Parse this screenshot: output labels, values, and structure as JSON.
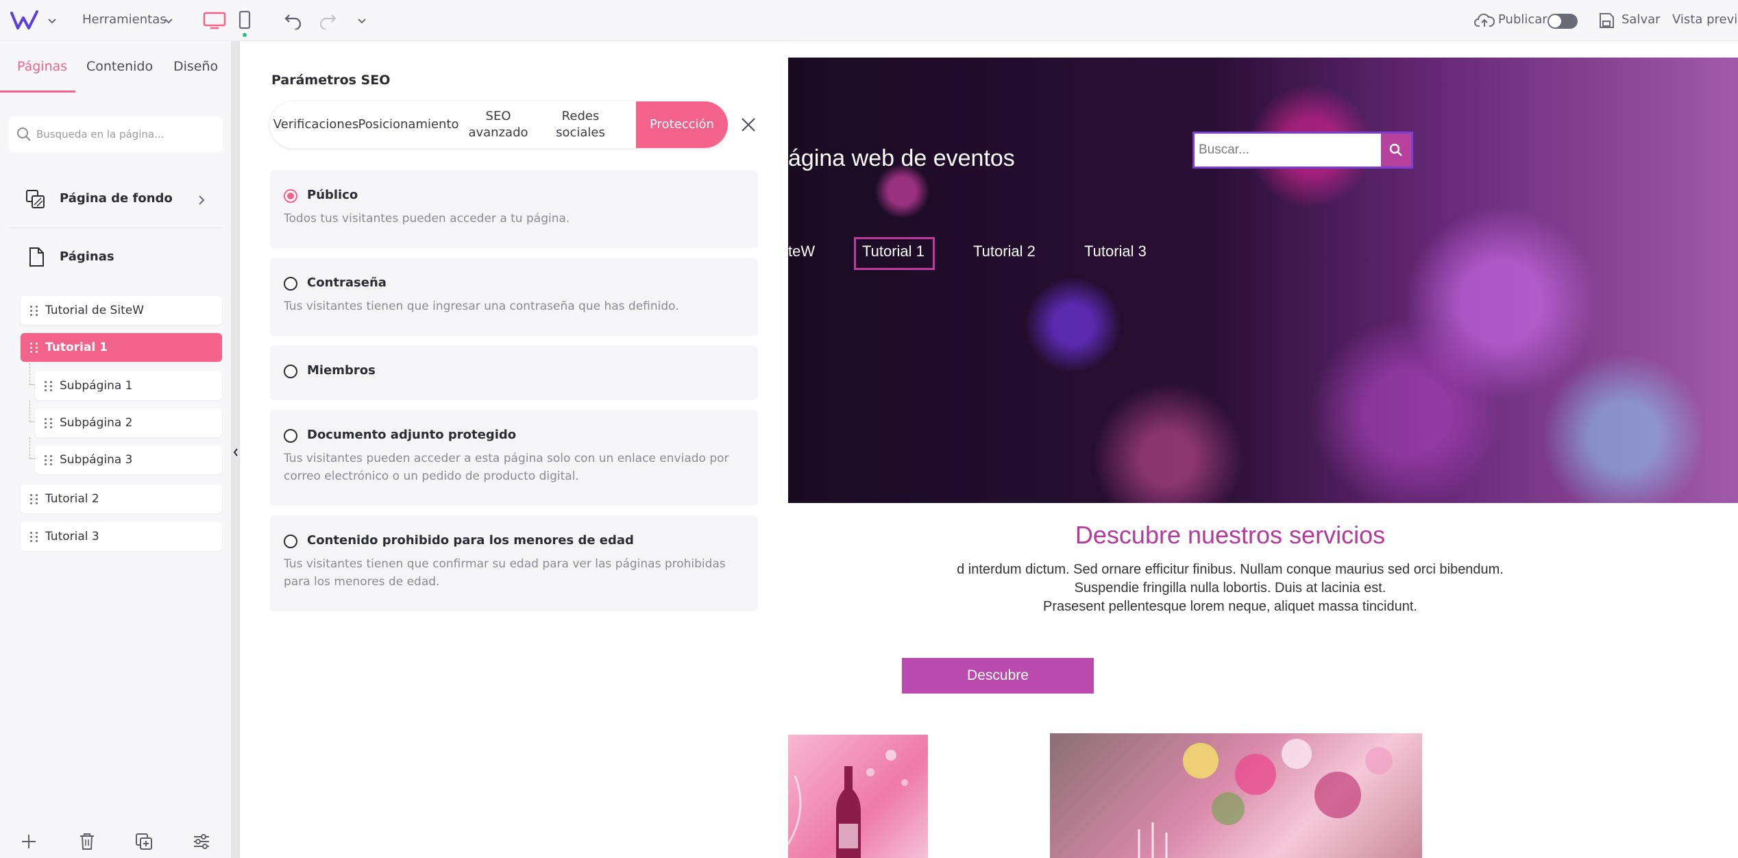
{
  "app": {
    "tools_label": "Herramientas",
    "publish_label": "Publicar",
    "save_label": "Salvar",
    "preview_label": "Vista previa",
    "accent_color": "#f2628a"
  },
  "sidebar": {
    "tabs": [
      {
        "label": "Páginas",
        "active": true
      },
      {
        "label": "Contenido",
        "active": false
      },
      {
        "label": "Diseño",
        "active": false
      }
    ],
    "search_placeholder": "Busqueda en la página...",
    "background_page_label": "Página de fondo",
    "pages_label": "Páginas",
    "pages": [
      {
        "label": "Tutorial de SiteW",
        "active": false,
        "level": 0
      },
      {
        "label": "Tutorial 1",
        "active": true,
        "level": 0
      },
      {
        "label": "Subpágina 1",
        "active": false,
        "level": 1
      },
      {
        "label": "Subpágina 2",
        "active": false,
        "level": 1
      },
      {
        "label": "Subpágina 3",
        "active": false,
        "level": 1
      },
      {
        "label": "Tutorial 2",
        "active": false,
        "level": 0
      },
      {
        "label": "Tutorial 3",
        "active": false,
        "level": 0
      }
    ]
  },
  "seo_panel": {
    "title": "Parámetros SEO",
    "tabs": [
      {
        "label": "Verificaciones",
        "active": false
      },
      {
        "label": "Posicionamiento",
        "active": false
      },
      {
        "label": "SEO avanzado",
        "active": false
      },
      {
        "label": "Redes sociales",
        "active": false
      },
      {
        "label": "Protección",
        "active": true
      }
    ],
    "options": [
      {
        "title": "Público",
        "description": "Todos tus visitantes pueden acceder a tu página.",
        "selected": true
      },
      {
        "title": "Contraseña",
        "description": "Tus visitantes tienen que ingresar una contraseña que has definido.",
        "selected": false
      },
      {
        "title": "Miembros",
        "description": "",
        "selected": false
      },
      {
        "title": "Documento adjunto protegido",
        "description": "Tus visitantes pueden acceder a esta página solo con un enlace enviado por correo electrónico o un pedido de producto digital.",
        "selected": false
      },
      {
        "title": "Contenido prohibido para los menores de edad",
        "description": "Tus visitantes tienen que confirmar su edad para ver las páginas prohibidas para los menores de edad.",
        "selected": false
      }
    ]
  },
  "preview": {
    "hero_title": "ágina web de eventos",
    "search_placeholder": "Buscar...",
    "nav": [
      "teW",
      "Tutorial 1",
      "Tutorial 2",
      "Tutorial 3"
    ],
    "services_title": "Descubre nuestros servicios",
    "services_lines": [
      "d interdum dictum. Sed ornare efficitur finibus. Nullam conque maurius sed orci bibendum.",
      "Suspendie fringilla nulla lobortis. Duis at lacinia est.",
      "Prasesent pellentesque lorem neque, aliquet massa tincidunt."
    ],
    "discover_label": "Descubre",
    "title_color": "#b13a9c"
  }
}
